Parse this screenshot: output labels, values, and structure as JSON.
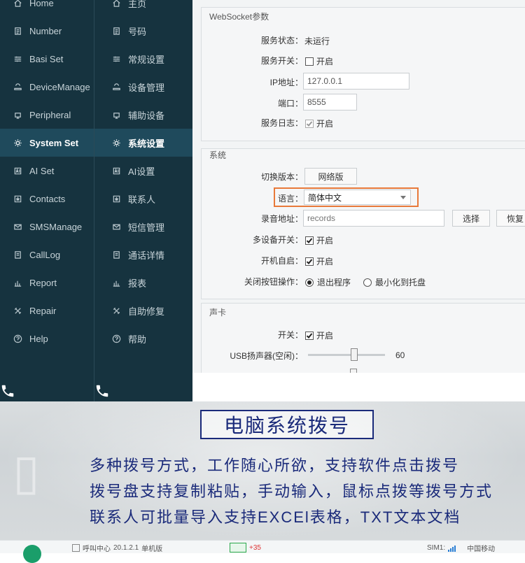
{
  "sidebar_en": {
    "items": [
      {
        "label": "Home",
        "icon": "home-icon"
      },
      {
        "label": "Number",
        "icon": "number-icon"
      },
      {
        "label": "Basi Set",
        "icon": "sliders-icon"
      },
      {
        "label": "DeviceManage",
        "icon": "device-icon"
      },
      {
        "label": "Peripheral",
        "icon": "peripheral-icon"
      },
      {
        "label": "System Set",
        "icon": "gear-icon",
        "active": true
      },
      {
        "label": "AI Set",
        "icon": "ai-icon"
      },
      {
        "label": "Contacts",
        "icon": "contacts-icon"
      },
      {
        "label": "SMSManage",
        "icon": "mail-icon"
      },
      {
        "label": "CallLog",
        "icon": "calllog-icon"
      },
      {
        "label": "Report",
        "icon": "chart-icon"
      },
      {
        "label": "Repair",
        "icon": "tools-icon"
      },
      {
        "label": "Help",
        "icon": "help-icon"
      }
    ]
  },
  "sidebar_cn": {
    "items": [
      {
        "label": "主页"
      },
      {
        "label": "号码"
      },
      {
        "label": "常规设置"
      },
      {
        "label": "设备管理"
      },
      {
        "label": "辅助设备"
      },
      {
        "label": "系统设置",
        "active": true
      },
      {
        "label": "AI设置"
      },
      {
        "label": "联系人"
      },
      {
        "label": "短信管理"
      },
      {
        "label": "通话详情"
      },
      {
        "label": "报表"
      },
      {
        "label": "自助修复"
      },
      {
        "label": "帮助"
      }
    ]
  },
  "websocket": {
    "title": "WebSocket参数",
    "status_label": "服务状态：",
    "status_value": "未运行",
    "switch_label": "服务开关：",
    "switch_text": "开启",
    "ip_label": "IP地址：",
    "ip_value": "127.0.0.1",
    "port_label": "端口：",
    "port_value": "8555",
    "log_label": "服务日志：",
    "log_text": "开启"
  },
  "system": {
    "title": "系统",
    "version_label": "切换版本：",
    "version_button": "网络版",
    "language_label": "语言：",
    "language_value": "简体中文",
    "record_label": "录音地址：",
    "record_value": "records",
    "choose_button": "选择",
    "restore_button": "恢复",
    "multi_label": "多设备开关：",
    "multi_text": "开启",
    "boot_label": "开机自启：",
    "boot_text": "开启",
    "close_label": "关闭按钮操作：",
    "close_opt1": "退出程序",
    "close_opt2": "最小化到托盘"
  },
  "soundcard": {
    "title": "声卡",
    "switch_label": "开关：",
    "switch_text": "开启",
    "usb_label": "USB扬声器(空闲)：",
    "usb_value": "60",
    "usb_level": 0.6
  },
  "banner": {
    "title": "电脑系统拨号",
    "lines": [
      "多种拨号方式，工作随心所欲，支持软件点击拨号",
      "拨号盘支持复制粘贴，手动输入，鼠标点拨等拨号方式",
      "联系人可批量导入支持EXCEl表格，TXT文本文档"
    ]
  },
  "statusbar": {
    "app": "呼叫中心",
    "version": "20.1.2.1",
    "mode": "单机版",
    "sms_count": "+35",
    "sim_label": "SIM1:",
    "carrier": "中国移动"
  },
  "colors": {
    "sidebar_bg": "#16333f",
    "sidebar_active": "#1f4a5c",
    "highlight": "#e8793a",
    "banner_text": "#1a2a7a"
  }
}
